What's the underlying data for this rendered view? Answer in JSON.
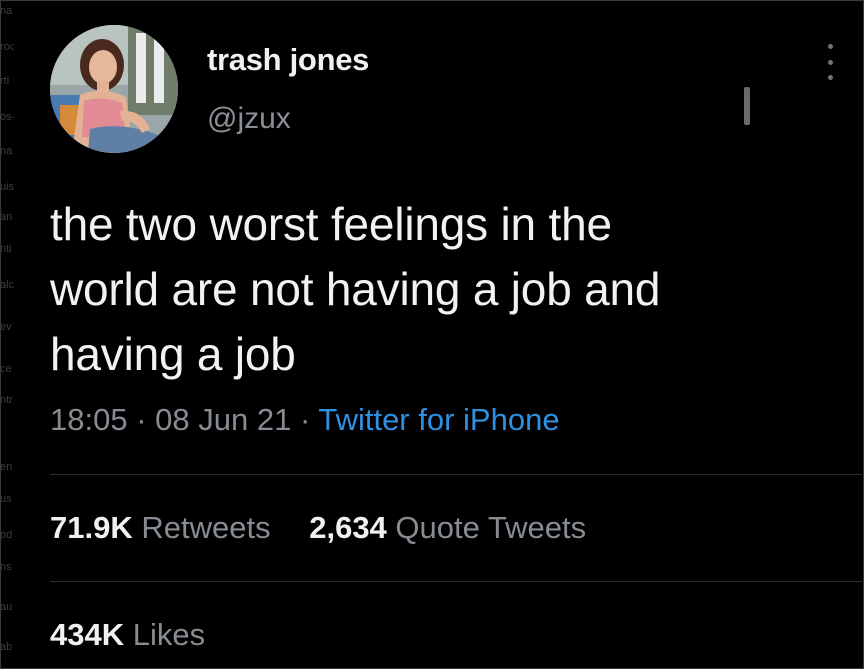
{
  "user": {
    "display_name": "trash jones",
    "handle": "@jzux"
  },
  "tweet": {
    "text": "the two worst feelings in the\nworld are not having a job and\nhaving a job",
    "time": "18:05",
    "separator": "·",
    "date": "08 Jun 21",
    "source": "Twitter for iPhone"
  },
  "stats": {
    "retweets": {
      "count": "71.9K",
      "label": "Retweets"
    },
    "quote_tweets": {
      "count": "2,634",
      "label": "Quote Tweets"
    },
    "likes": {
      "count": "434K",
      "label": "Likes"
    }
  },
  "icons": {
    "more": "more-vertical-icon"
  },
  "colors": {
    "background": "#000000",
    "text_primary": "#f1f1f1",
    "text_secondary": "#868c92",
    "link": "#2f8fe0",
    "divider": "#2a2a2a"
  },
  "edge_fragments": [
    "na",
    "roc",
    "rti",
    "os-",
    "na",
    "uis",
    "an",
    "nti",
    "alc",
    "ev",
    "ce",
    "ntr",
    "en",
    "us",
    "od",
    "ns",
    "au",
    "ab"
  ]
}
